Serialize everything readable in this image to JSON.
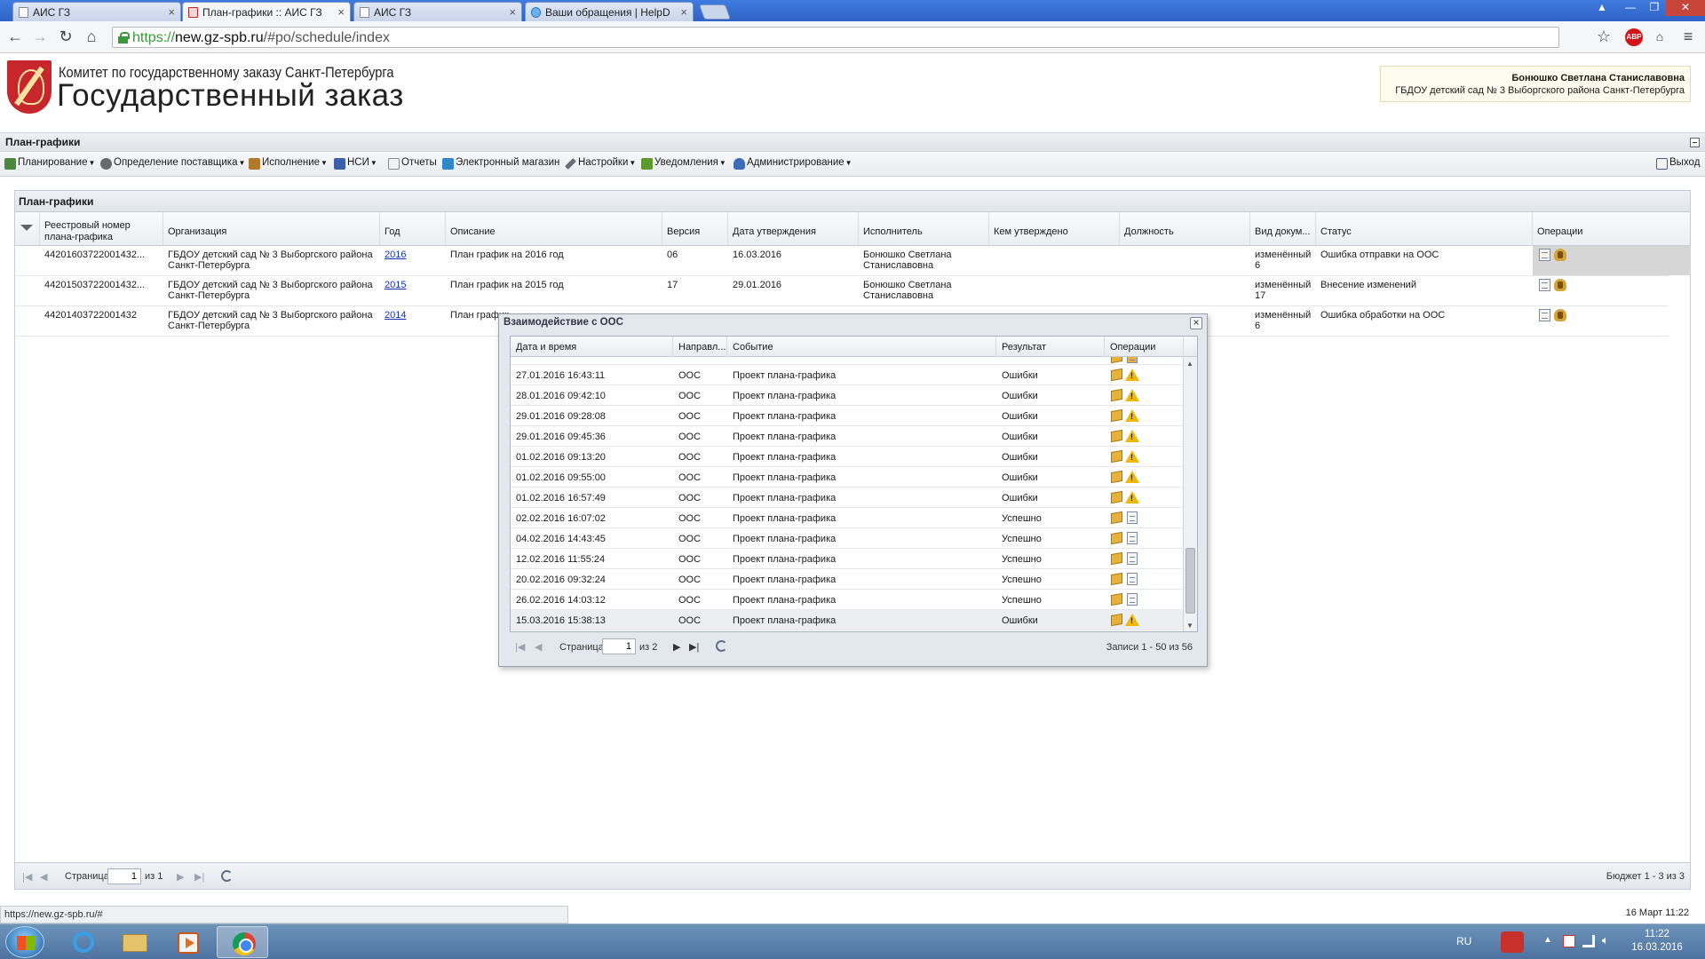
{
  "browser": {
    "tabs": [
      {
        "title": "АИС ГЗ",
        "active": false
      },
      {
        "title": "План-графики :: АИС ГЗ",
        "active": true
      },
      {
        "title": "АИС ГЗ",
        "active": false
      },
      {
        "title": "Ваши обращения | HelpD",
        "active": false
      }
    ],
    "url_prefix": "https://",
    "url_host": "new.gz-spb.ru",
    "url_path": "/#po/schedule/index",
    "status_url": "https://new.gz-spb.ru/#"
  },
  "header": {
    "org_line": "Комитет по государственному заказу Санкт-Петербурга",
    "system_name": "Государственный заказ",
    "user_name": "Бонюшко Светлана Станиславовна",
    "user_org": "ГБДОУ детский сад № 3 Выборгского района Санкт-Петербурга"
  },
  "panel_title": "План-графики",
  "menu": [
    {
      "label": "Планирование",
      "dropdown": true,
      "icon": "planning-icon",
      "color": "#4a8a3c"
    },
    {
      "label": "Определение поставщика",
      "dropdown": true,
      "icon": "supplier-icon",
      "color": "#6a6a6a"
    },
    {
      "label": "Исполнение",
      "dropdown": true,
      "icon": "execution-icon",
      "color": "#b07a2a"
    },
    {
      "label": "НСИ",
      "dropdown": true,
      "icon": "reference-icon",
      "color": "#3b5fa8"
    },
    {
      "label": "Отчеты",
      "dropdown": false,
      "icon": "reports-icon",
      "color": "#8a8a8a"
    },
    {
      "label": "Электронный магазин",
      "dropdown": false,
      "icon": "cart-icon",
      "color": "#2f86c8"
    },
    {
      "label": "Настройки",
      "dropdown": true,
      "icon": "wrench-icon",
      "color": "#6b6f78"
    },
    {
      "label": "Уведомления",
      "dropdown": true,
      "icon": "notifications-icon",
      "color": "#5c9a2e"
    },
    {
      "label": "Администрирование",
      "dropdown": true,
      "icon": "admin-icon",
      "color": "#3e6bb5"
    }
  ],
  "logout_label": "Выход",
  "grid": {
    "title": "План-графики",
    "columns": [
      "Реестровый номер плана-графика",
      "Организация",
      "Год",
      "Описание",
      "Версия",
      "Дата утверждения",
      "Исполнитель",
      "Кем утверждено",
      "Должность",
      "Вид докум...",
      "Статус",
      "Операции"
    ],
    "rows": [
      {
        "reg_no": "44201603722001432...",
        "org": "ГБДОУ детский сад № 3 Выборгского района Санкт-Петербурга",
        "year": "2016",
        "desc": "План график на 2016 год",
        "version": "06",
        "approved": "16.03.2016",
        "executor": "Бонюшко Светлана Станиславовна",
        "approved_by": "",
        "position": "",
        "doc_type": "изменённый 6",
        "status": "Ошибка отправки на ООС"
      },
      {
        "reg_no": "44201503722001432...",
        "org": "ГБДОУ детский сад № 3 Выборгского района Санкт-Петербурга",
        "year": "2015",
        "desc": "План график на 2015 год",
        "version": "17",
        "approved": "29.01.2016",
        "executor": "Бонюшко Светлана Станиславовна",
        "approved_by": "",
        "position": "",
        "doc_type": "изменённый 17",
        "status": "Внесение изменений"
      },
      {
        "reg_no": "44201403722001432",
        "org": "ГБДОУ детский сад № 3 Выборгского района Санкт-Петербурга",
        "year": "2014",
        "desc": "План график",
        "version": "",
        "approved": "",
        "executor": "",
        "approved_by": "",
        "position": "",
        "doc_type": "изменённый 6",
        "status": "Ошибка обработки на ООС"
      }
    ],
    "pager": {
      "page_label": "Страница",
      "page": "1",
      "of_label": "из 1",
      "summary": "Бюджет 1 - 3 из 3"
    }
  },
  "modal": {
    "title": "Взаимодействие с ООС",
    "columns": [
      "Дата и время",
      "Направл...",
      "Событие",
      "Результат",
      "Операции"
    ],
    "rows": [
      {
        "datetime": "27.01.2016 16:43:11",
        "dir": "ООС",
        "event": "Проект плана-графика",
        "result": "Ошибки"
      },
      {
        "datetime": "28.01.2016 09:42:10",
        "dir": "ООС",
        "event": "Проект плана-графика",
        "result": "Ошибки"
      },
      {
        "datetime": "29.01.2016 09:28:08",
        "dir": "ООС",
        "event": "Проект плана-графика",
        "result": "Ошибки"
      },
      {
        "datetime": "29.01.2016 09:45:36",
        "dir": "ООС",
        "event": "Проект плана-графика",
        "result": "Ошибки"
      },
      {
        "datetime": "01.02.2016 09:13:20",
        "dir": "ООС",
        "event": "Проект плана-графика",
        "result": "Ошибки"
      },
      {
        "datetime": "01.02.2016 09:55:00",
        "dir": "ООС",
        "event": "Проект плана-графика",
        "result": "Ошибки"
      },
      {
        "datetime": "01.02.2016 16:57:49",
        "dir": "ООС",
        "event": "Проект плана-графика",
        "result": "Ошибки"
      },
      {
        "datetime": "02.02.2016 16:07:02",
        "dir": "ООС",
        "event": "Проект плана-графика",
        "result": "Успешно"
      },
      {
        "datetime": "04.02.2016 14:43:45",
        "dir": "ООС",
        "event": "Проект плана-графика",
        "result": "Успешно"
      },
      {
        "datetime": "12.02.2016 11:55:24",
        "dir": "ООС",
        "event": "Проект плана-графика",
        "result": "Успешно"
      },
      {
        "datetime": "20.02.2016 09:32:24",
        "dir": "ООС",
        "event": "Проект плана-графика",
        "result": "Успешно"
      },
      {
        "datetime": "26.02.2016 14:03:12",
        "dir": "ООС",
        "event": "Проект плана-графика",
        "result": "Успешно"
      },
      {
        "datetime": "15.03.2016 15:38:13",
        "dir": "ООС",
        "event": "Проект плана-графика",
        "result": "Ошибки"
      }
    ],
    "pager": {
      "page_label": "Страница",
      "page": "1",
      "of_label": "из 2",
      "summary": "Записи 1 - 50 из 56"
    }
  },
  "app_date": "16 Март 11:22",
  "taskbar": {
    "lang": "RU",
    "time": "11:22",
    "date": "16.03.2016"
  }
}
